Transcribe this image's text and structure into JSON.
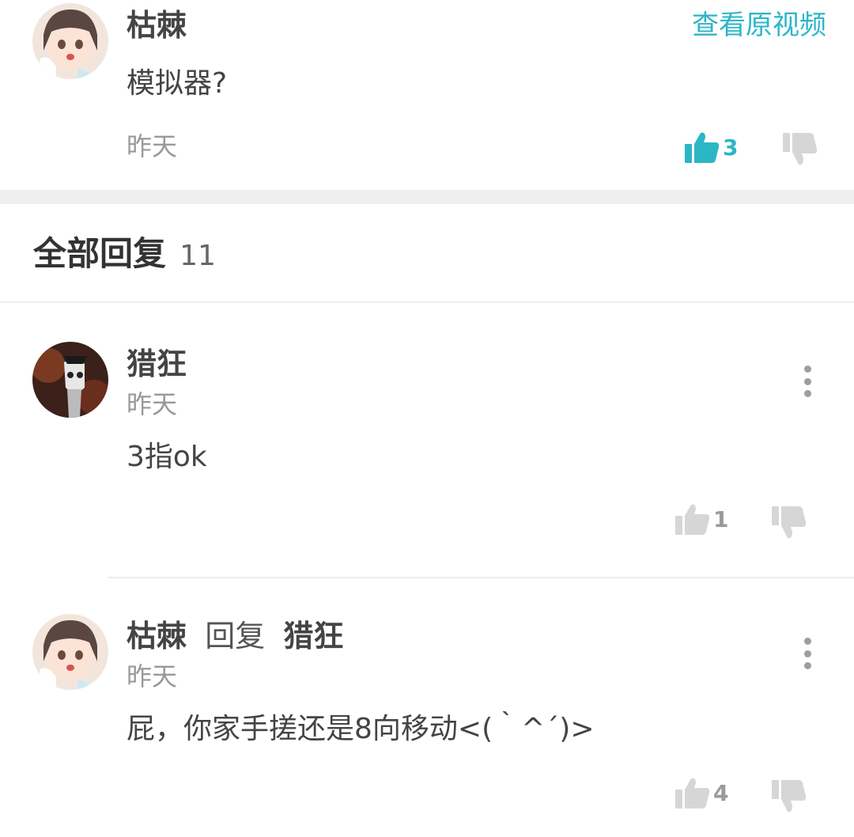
{
  "main_comment": {
    "author": "枯棘",
    "view_original_label": "查看原视频",
    "text": "模拟器?",
    "time": "昨天",
    "like_count": "3"
  },
  "replies_header": {
    "label": "全部回复",
    "count": "11"
  },
  "replies": [
    {
      "author": "猎狂",
      "time": "昨天",
      "text": "3指ok",
      "like_count": "1"
    },
    {
      "author": "枯棘",
      "reply_word": "回复",
      "reply_to": "猎狂",
      "time": "昨天",
      "text": "屁，你家手搓还是8向移动<(｀^´)>",
      "like_count": "4"
    }
  ],
  "colors": {
    "accent": "#2bb6c6",
    "icon_gray": "#d6d6d6",
    "text_gray": "#999999",
    "divider": "#efefef"
  }
}
